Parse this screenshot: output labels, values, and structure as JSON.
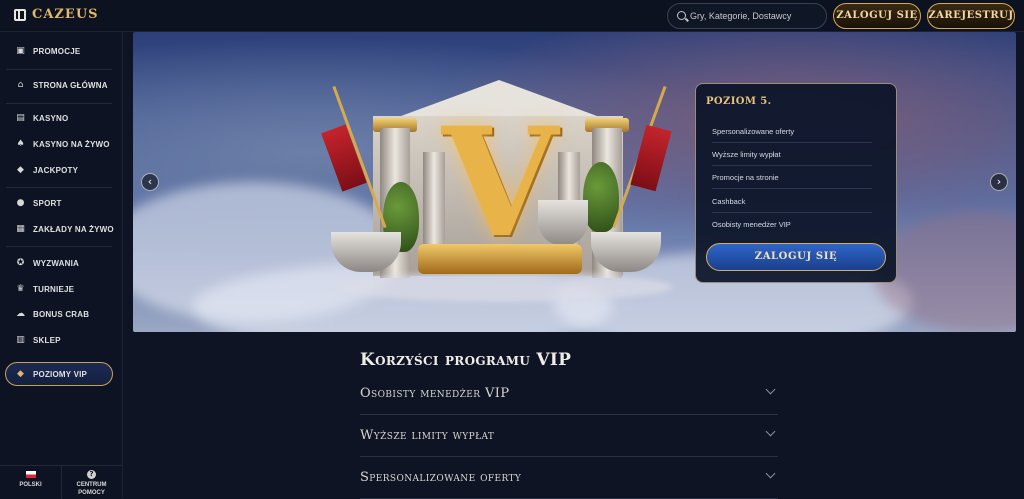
{
  "header": {
    "logo": "CAZEUS",
    "search_placeholder": "Gry, Kategorie, Dostawcy",
    "login_label": "ZALOGUJ SIĘ",
    "register_label": "ZAREJESTRUJ"
  },
  "sidebar": {
    "items": [
      {
        "label": "PROMOCJE",
        "icon": "gift-icon"
      },
      {
        "label": "STRONA GŁÓWNA",
        "icon": "home-icon"
      },
      {
        "label": "KASYNO",
        "icon": "slot-icon"
      },
      {
        "label": "KASYNO NA ŻYWO",
        "icon": "cards-icon"
      },
      {
        "label": "JACKPOTY",
        "icon": "diamond-icon"
      },
      {
        "label": "SPORT",
        "icon": "ball-icon"
      },
      {
        "label": "ZAKŁADY NA ŻYWO",
        "icon": "live-bet-icon"
      },
      {
        "label": "WYZWANIA",
        "icon": "medal-icon"
      },
      {
        "label": "TURNIEJE",
        "icon": "trophy-icon"
      },
      {
        "label": "BONUS CRAB",
        "icon": "crab-icon"
      },
      {
        "label": "SKLEP",
        "icon": "shop-icon"
      }
    ],
    "vip_label": "POZIOMY VIP",
    "footer": {
      "language": "POLSKI",
      "help_line1": "CENTRUM",
      "help_line2": "POMOCY"
    }
  },
  "hero": {
    "level_title": "POZIOM 5.",
    "perks": [
      "Spersonalizowane oferty",
      "Wyższe limity wypłat",
      "Promocje na stronie",
      "Cashback",
      "Osobisty menedżer VIP"
    ],
    "login_label": "ZALOGUJ SIĘ"
  },
  "benefits": {
    "title": "Korzyści programu VIP",
    "items": [
      "Osobisty menedżer VIP",
      "Wyższe limity wypłat",
      "Spersonalizowane oferty"
    ]
  },
  "colors": {
    "accent_gold": "#d6a954",
    "background": "#0e1424",
    "vip_blue": "#1c2a55"
  }
}
